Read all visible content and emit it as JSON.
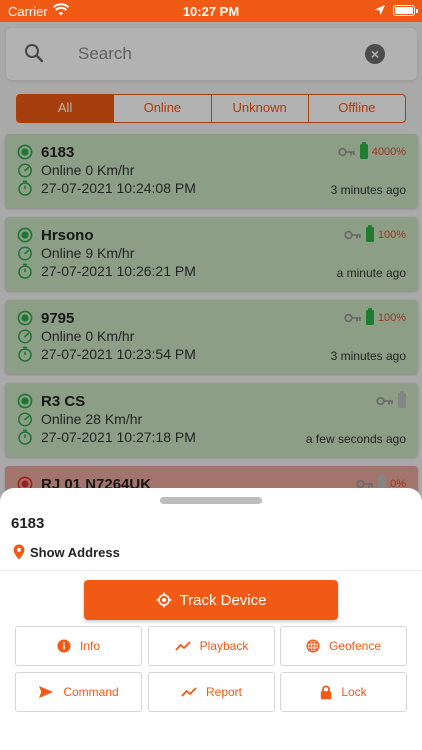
{
  "status_bar": {
    "carrier": "Carrier",
    "time": "10:27 PM"
  },
  "search": {
    "placeholder": "Search"
  },
  "filters": [
    {
      "label": "All",
      "active": true
    },
    {
      "label": "Online",
      "active": false
    },
    {
      "label": "Unknown",
      "active": false
    },
    {
      "label": "Offline",
      "active": false
    }
  ],
  "devices": [
    {
      "name": "6183",
      "status": "Online 0 Km/hr",
      "datetime": "27-07-2021 10:24:08 PM",
      "ago": "3 minutes ago",
      "battery": "4000%"
    },
    {
      "name": "Hrsono",
      "status": "Online 9 Km/hr",
      "datetime": "27-07-2021 10:26:21 PM",
      "ago": "a minute ago",
      "battery": "100%"
    },
    {
      "name": "9795",
      "status": "Online 0 Km/hr",
      "datetime": "27-07-2021 10:23:54 PM",
      "ago": "3 minutes ago",
      "battery": "100%"
    },
    {
      "name": "R3 CS",
      "status": "Online 28 Km/hr",
      "datetime": "27-07-2021 10:27:18 PM",
      "ago": "a few seconds ago",
      "battery": ""
    },
    {
      "name": "RJ 01 N7264UK",
      "battery": "0%"
    }
  ],
  "sheet": {
    "device_name": "6183",
    "show_address": "Show Address",
    "track_device": "Track Device",
    "actions": {
      "info": "Info",
      "playback": "Playback",
      "geofence": "Geofence",
      "command": "Command",
      "report": "Report",
      "lock": "Lock"
    }
  },
  "colors": {
    "accent": "#f05a14",
    "online_card": "#c9e3c1",
    "offline_card": "#e9a69a",
    "battery_ok": "#2db24a",
    "online_icon": "#2aa64a"
  }
}
